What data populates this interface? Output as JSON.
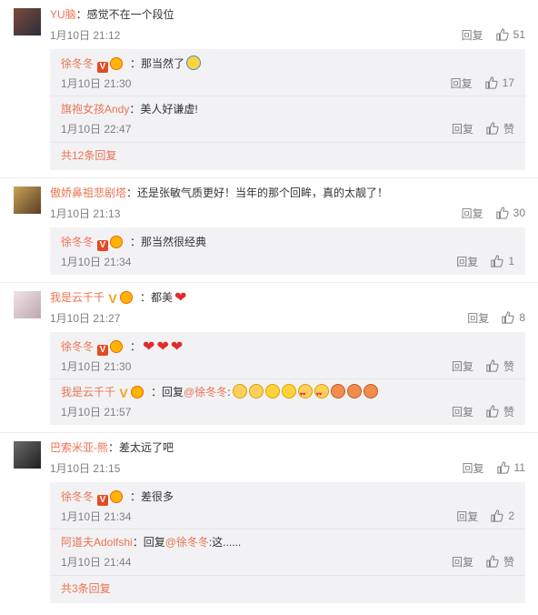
{
  "labels": {
    "reply": "回复",
    "like": "赞"
  },
  "comments": [
    {
      "user": "YU脑",
      "text": "：感觉不在一个段位",
      "time": "1月10日 21:12",
      "likes": "51",
      "replies": [
        {
          "user": "徐冬冬",
          "text": "：那当然了",
          "time": "1月10日 21:30",
          "likes": "17"
        },
        {
          "user": "旗袍女孩Andy",
          "text": "：美人好谦虚!",
          "time": "1月10日 22:47"
        }
      ],
      "more": "共12条回复"
    },
    {
      "user": "傲娇鼻祖悲剧塔",
      "text": "：还是张敏气质更好！当年的那个回眸，真的太靓了！",
      "time": "1月10日 21:13",
      "likes": "30",
      "replies": [
        {
          "user": "徐冬冬",
          "text": "：那当然很经典",
          "time": "1月10日 21:34",
          "likes": "1"
        }
      ]
    },
    {
      "user": "我是云千千",
      "text": "：都美",
      "time": "1月10日 21:27",
      "likes": "8",
      "replies": [
        {
          "user": "徐冬冬",
          "text": "：",
          "time": "1月10日 21:30"
        },
        {
          "user": "我是云千千",
          "text": "：回复",
          "mention": "@徐冬冬",
          "tail": ":",
          "time": "1月10日 21:57"
        }
      ]
    },
    {
      "user": "巴索米亚-熊",
      "text": "：差太远了吧",
      "time": "1月10日 21:15",
      "likes": "11",
      "replies": [
        {
          "user": "徐冬冬",
          "text": "：差很多",
          "time": "1月10日 21:34",
          "likes": "2"
        },
        {
          "user": "阿道夫Adolfshi",
          "text": "：回复",
          "mention": "@徐冬冬",
          "tail": ":这......",
          "time": "1月10日 21:44"
        }
      ],
      "more": "共3条回复"
    }
  ],
  "icons": {
    "like": "thumbs-up-icon",
    "verified": "verified-v-icon",
    "member": "member-badge-icon"
  },
  "colors": {
    "name": "#eb7350",
    "meta": "#808080",
    "reply_bg": "#f2f2f5",
    "text": "#333333"
  }
}
